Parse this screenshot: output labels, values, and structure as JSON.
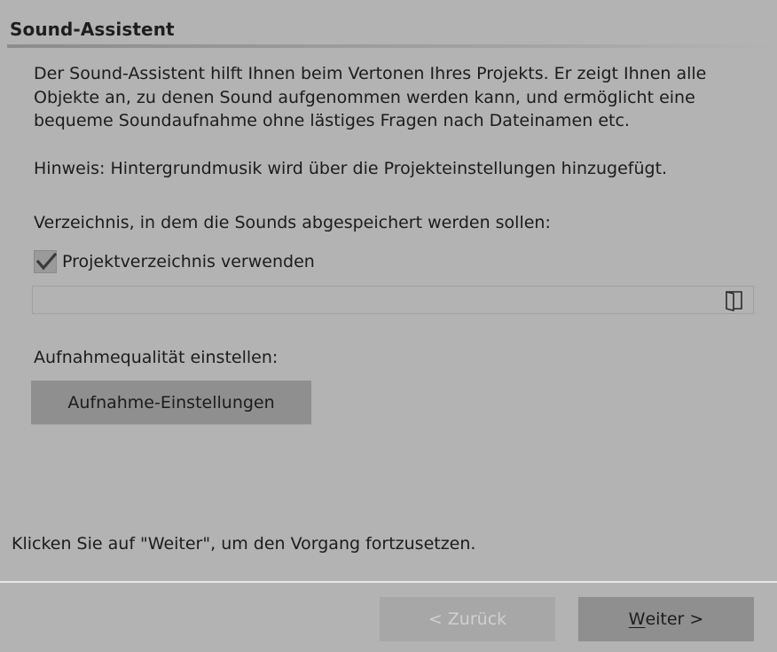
{
  "dialog": {
    "title": "Sound-Assistent",
    "intro_line1": "Der Sound-Assistent hilft Ihnen beim Vertonen Ihres Projekts. Er zeigt Ihnen alle",
    "intro_line2": "Objekte an, zu denen Sound aufgenommen werden kann, und ermöglicht eine",
    "intro_line3": "bequeme Soundaufnahme ohne lästiges Fragen nach Dateinamen etc.",
    "hint": "Hinweis: Hintergrundmusik wird über die Projekteinstellungen hinzugefügt.",
    "directory_label": "Verzeichnis, in dem die Sounds abgespeichert werden sollen:",
    "use_project_dir": {
      "label": "Projektverzeichnis verwenden",
      "checked": true
    },
    "path_field": {
      "value": "",
      "placeholder": ""
    },
    "folder_icon": "folder-open-icon",
    "quality_label": "Aufnahmequalität einstellen:",
    "recording_settings_button": "Aufnahme-Einstellungen",
    "footer_text": "Klicken Sie auf \"Weiter\", um den Vorgang fortzusetzen."
  },
  "buttons": {
    "back_label": "< Zurück",
    "back_enabled": false,
    "next_mnemonic": "W",
    "next_rest": "eiter >"
  },
  "colors": {
    "background": "#b3b3b3",
    "button": "#8f8f8f",
    "disabled_button": "#a7a7a7",
    "text": "#1c1c1c",
    "disabled_text": "#d0d0d0"
  }
}
